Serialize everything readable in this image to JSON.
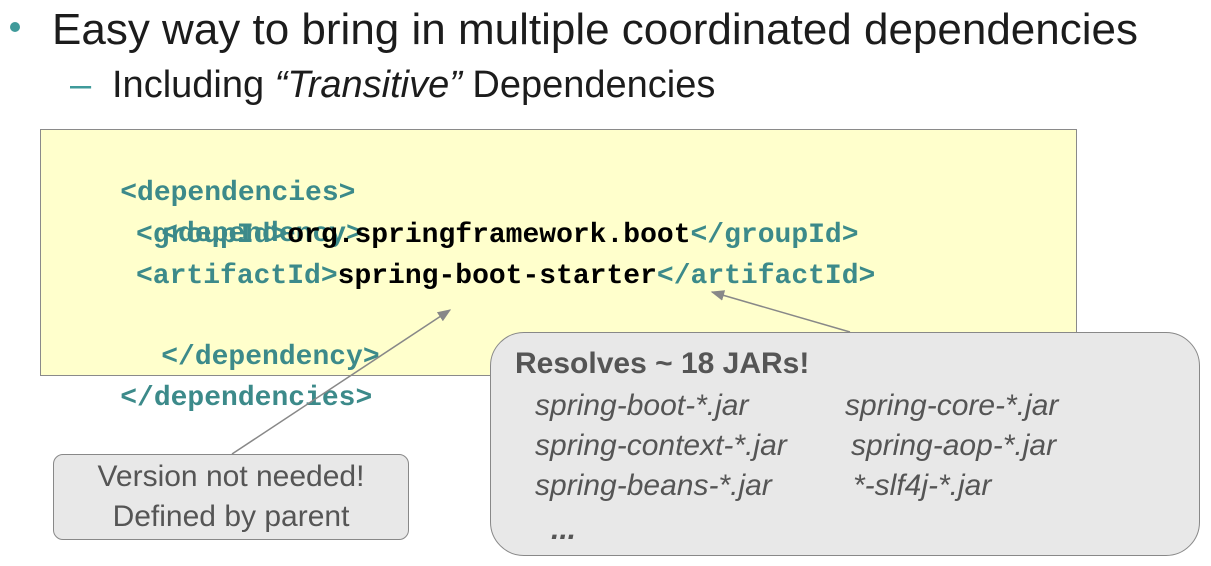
{
  "bullet": {
    "text": "Easy way to bring in multiple coordinated dependencies"
  },
  "sub_bullet": {
    "dash": "–",
    "prefix": "Including ",
    "italic": "“Transitive”",
    "suffix": " Dependencies"
  },
  "code": {
    "line1": "<dependencies>",
    "line2": "<dependency>",
    "line3_open": "<groupId>",
    "line3_value": "org.springframework.boot",
    "line3_close": "</groupId>",
    "line4_open": "<artifactId>",
    "line4_value": "spring-boot-starter",
    "line4_close": "</artifactId>",
    "line5": "</dependency>",
    "line6": "</dependencies>"
  },
  "resolves_callout": {
    "title": "Resolves ~ 18 JARs!",
    "jars": [
      "spring-boot-*.jar",
      "spring-core-*.jar",
      "spring-context-*.jar",
      "spring-aop-*.jar",
      "spring-beans-*.jar",
      "*-slf4j-*.jar"
    ],
    "ellipsis": "..."
  },
  "version_callout": {
    "line1": "Version not needed!",
    "line2": "Defined by parent"
  },
  "colors": {
    "accent": "#3f9a9a",
    "tag": "#3c8a8a",
    "code_background": "#ffffcc",
    "callout_background": "#e8e8e8",
    "callout_text": "#555555"
  }
}
